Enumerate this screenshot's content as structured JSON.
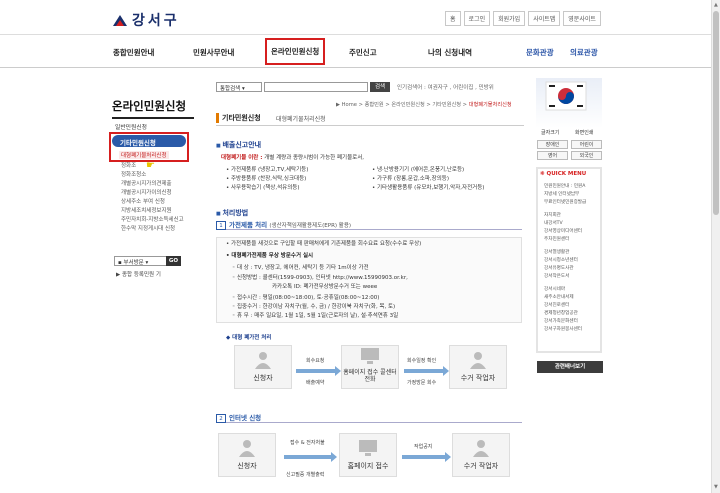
{
  "header": {
    "logo_text": "강서구",
    "top_links": [
      "홈",
      "로그인",
      "회원가입",
      "사이트맵",
      "영문사이트"
    ]
  },
  "gnb": {
    "items": [
      "종합민원안내",
      "민원사무안내",
      "온라인민원신청",
      "주민신고",
      "나의 신청내역"
    ],
    "extra": [
      "문화관광",
      "의료관광"
    ]
  },
  "search": {
    "type_label": "통합검색",
    "button_label": "검색",
    "popular": "인기검색어 : 여권자구 , 어린이집 , 민방위"
  },
  "lnb": {
    "title": "온라인민원신청",
    "items": [
      "일반민원신청",
      "기타민원신청"
    ],
    "sub_items": [
      "대형폐기물처리신청",
      "정화조",
      "정화조청소",
      "개별공시지가의견제출",
      "개별공시지가이의신청",
      "상세주소 부여 신청",
      "지방세조치세정보지원",
      "주민자치회-지방소득세신고",
      "한수막 지정게시대 신청"
    ],
    "dept_select": "부서방문",
    "go_label": "GO",
    "dept_link": "▶ 종합 등록민원 기"
  },
  "breadcrumb": {
    "path": "▶ Home > 종합민원 > 온라인민원신청 > 기타민원신청 >",
    "current": "대형폐기물처리신청"
  },
  "page": {
    "tab_main": "기타민원신청",
    "tab_sub": "대형폐기물처리신청"
  },
  "section1": {
    "title": "배출신고안내",
    "definition_label": "대형폐기물 이란 :",
    "definition": "개별 계량과 종량시범이 가능한 폐기물로서,",
    "items_left": [
      "• 가전제품류 (냉장고,TV,세탁기등)",
      "• 주방용품류 (찬장,식탁,싱크대등)",
      "• 사무용학습기 (책상,석유의등)"
    ],
    "items_right": [
      "• 냉·난방용기기 (에어콘,온풍기,난로등)",
      "• 가구류 (장롱,문갑,소파,장의등)",
      "• 기타생활용품류 (유모차,보행기,악자,자전거등)"
    ]
  },
  "section2": {
    "title": "처리방법",
    "sub1_num": "1",
    "sub1_title": "가전제품 처리",
    "sub1_desc": "(생산자책임재활용제도(EPR) 활용)",
    "sub1_lines": [
      "• 가전제품을 새것으로 구입할 때 판매처에게 기존제품을 회수요료 요청(수수료 무상)",
      "• 대형폐가전제품 무상 방문수거 실시",
      "◦ 대 상 : TV, 냉장고, 에어컨, 세탁기 등 기타 1m이상 가전",
      "◦ 신청방법 : 콜센터(1599-0903), 인터넷 http://www.15990903.or.kr,",
      "카카오톡 ID: 폐가전무상방문수거 또는 weee",
      "◦ 접수시간 : 평일(08:00~18:00), 토·공휴일(08:00~12:00)",
      "◦ 집중수거 : 한강이남 자치구(월, 수, 금) / 한강이북 자치구(화, 목, 토)",
      "◦ 휴 무 : 매주 일요일, 1월 1일, 5월 1일(근로자의 날), 설·추석연휴 3일"
    ],
    "flow1_title": "대형 폐가전 처리",
    "flow1_boxes": [
      "신청자",
      "홈페이지 접수 콜센터 전화",
      "수거 작업자"
    ],
    "flow1_labels": [
      "회수요청",
      "배출예약",
      "회수일정 확인",
      "가정방문 회수"
    ],
    "sub2_num": "2",
    "sub2_title": "인터넷 신청",
    "flow2_boxes": [
      "신청자",
      "홈페이지 접수",
      "수거 작업자"
    ],
    "flow2_labels": [
      "접수 & 전자처불",
      "신고필증 개별출력",
      "작업공지"
    ]
  },
  "right": {
    "title_links": [
      "글자크기",
      "화면인쇄"
    ],
    "grid": [
      "장애인",
      "어린이",
      "영어",
      "외국인"
    ],
    "quick_title": "QUICK MENU",
    "quick_items": [
      "민원민원안내 : 민원A",
      "지방세 인터넷납부",
      "무료인터넷민원증발급",
      "자치회관",
      "내강서TV",
      "강서영상미디어센터",
      "주차민원센터",
      "강서열생활관",
      "강서시청소년센터",
      "강서유명도사관",
      "강서작은도서",
      "강서시네마",
      "새주소안내서제",
      "강서진로센터",
      "경제청년창업공관",
      "강서가족문화센터",
      "강서구자원봉사센터"
    ],
    "button": "관련배너보기"
  },
  "colors": {
    "brand_blue": "#2a5aa8",
    "highlight_red": "#d61f1f",
    "accent_orange": "#e27a00"
  }
}
